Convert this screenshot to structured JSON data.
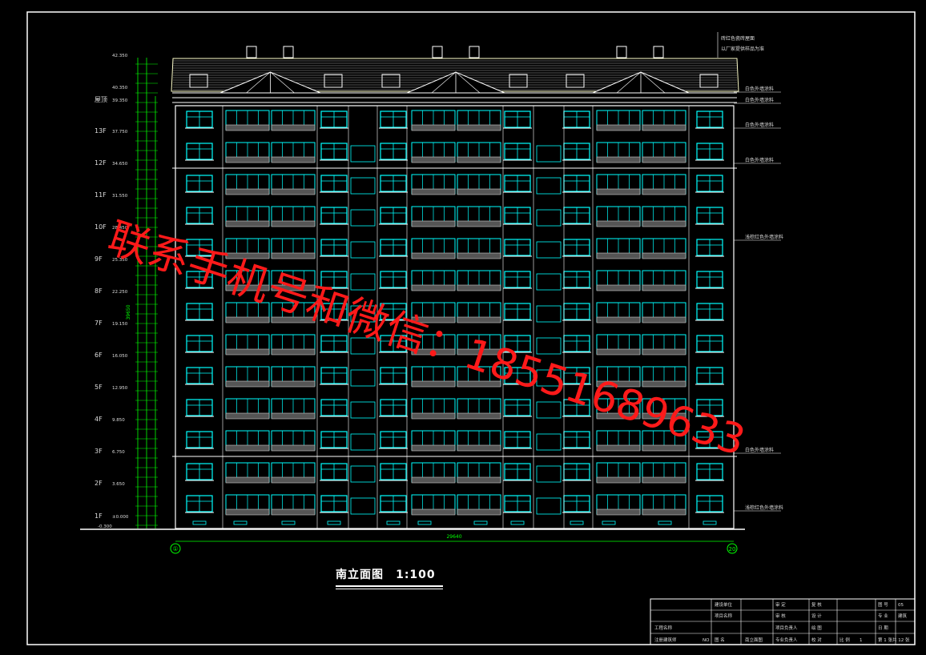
{
  "drawing": {
    "title": "南立面图",
    "scale": "1:100",
    "total_width_dim": "29640",
    "axis_start": "①",
    "axis_end": "20"
  },
  "floors": {
    "labels": [
      "屋顶",
      "13F",
      "12F",
      "11F",
      "10F",
      "9F",
      "8F",
      "7F",
      "6F",
      "5F",
      "4F",
      "3F",
      "2F",
      "1F"
    ],
    "elevations": [
      "39.350",
      "37.750",
      "34.650",
      "31.550",
      "28.450",
      "25.350",
      "22.250",
      "19.150",
      "16.050",
      "12.950",
      "9.850",
      "6.750",
      "3.650",
      "±0.000"
    ],
    "top_elevations": [
      "42.350",
      "40.350"
    ],
    "ground_elevation": "-0.300",
    "total_height_dim": "39650"
  },
  "callouts": [
    "砖红色瓷砖屋面",
    "白色外墙涂料",
    "白色外墙涂料",
    "白色外墙涂料",
    "白色外墙涂料",
    "浅棕红色外墙涂料",
    "白色外墙涂料",
    "浅棕红色外墙涂料"
  ],
  "roof_callout_lines": [
    "砖红色瓷砖屋面",
    "以厂家提供样品为准"
  ],
  "title_block": {
    "r1": [
      "建设单位",
      "审 定",
      "复 核",
      "图 号",
      "05"
    ],
    "r2": [
      "项目名称",
      "审 核",
      "设 计",
      "专 业",
      "建筑"
    ],
    "r3": [
      "工程名称",
      "项目负责人",
      "绘 图",
      "日 期"
    ],
    "r4": [
      "注册建筑师",
      "图 名",
      "南立面图",
      "专业负责人",
      "校 对",
      "比 例",
      "1",
      "第 1 张共 12 张"
    ],
    "reg_no": "NO"
  },
  "watermark": "联系手机号和微信：18551689633",
  "colors": {
    "background": "#000000",
    "frame": "#ffffff",
    "window": "#00ffff",
    "grid": "#00ff00",
    "wall": "#ffffff",
    "roof": "#ffffcc",
    "watermark": "#ff1a1a"
  }
}
